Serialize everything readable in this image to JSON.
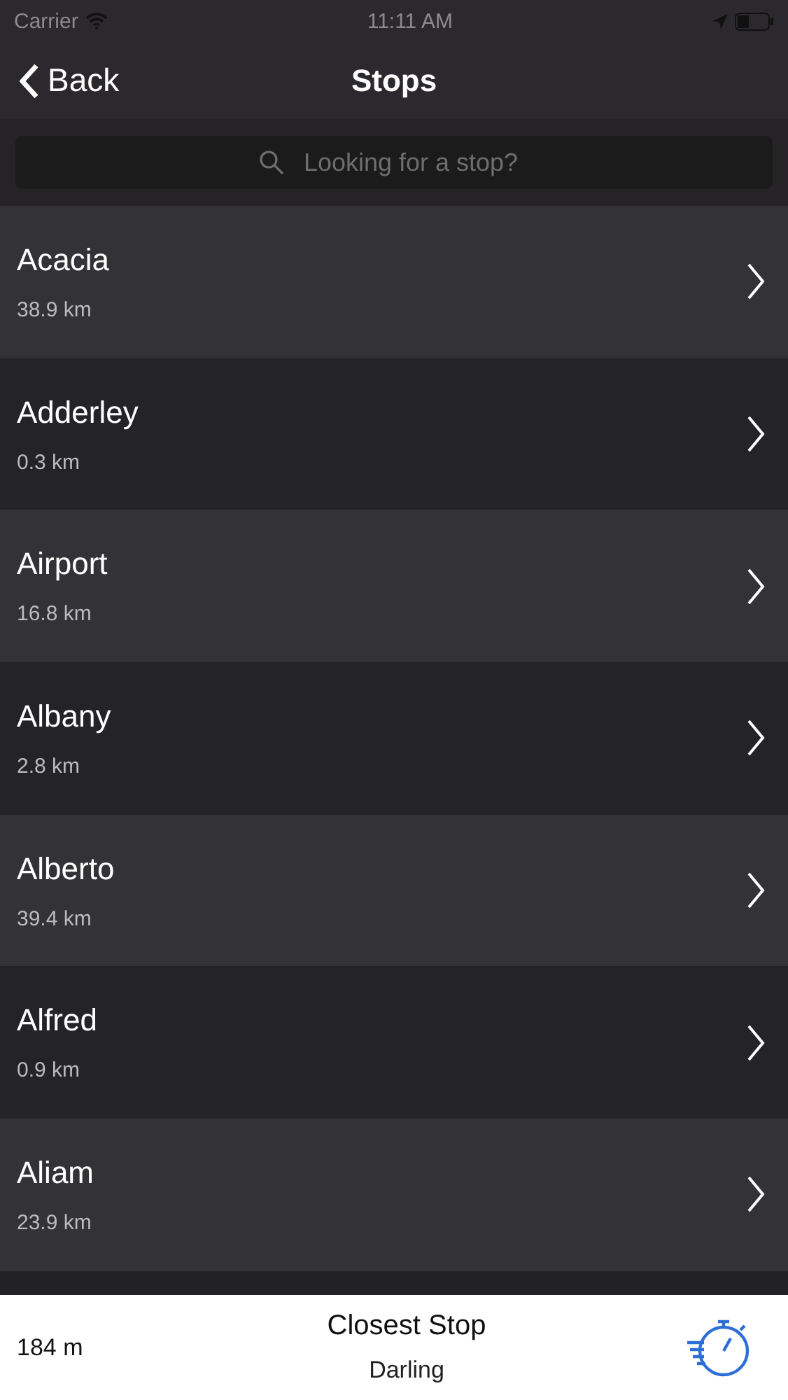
{
  "status_bar": {
    "carrier": "Carrier",
    "time": "11:11 AM"
  },
  "nav": {
    "back": "Back",
    "title": "Stops"
  },
  "search": {
    "placeholder": "Looking for a stop?"
  },
  "stops": [
    {
      "name": "Acacia",
      "distance": "38.9 km"
    },
    {
      "name": "Adderley",
      "distance": "0.3 km"
    },
    {
      "name": "Airport",
      "distance": "16.8 km"
    },
    {
      "name": "Albany",
      "distance": "2.8 km"
    },
    {
      "name": "Alberto",
      "distance": "39.4 km"
    },
    {
      "name": "Alfred",
      "distance": "0.9 km"
    },
    {
      "name": "Aliam",
      "distance": "23.9 km"
    }
  ],
  "closest": {
    "distance": "184 m",
    "title": "Closest Stop",
    "stop": "Darling"
  }
}
